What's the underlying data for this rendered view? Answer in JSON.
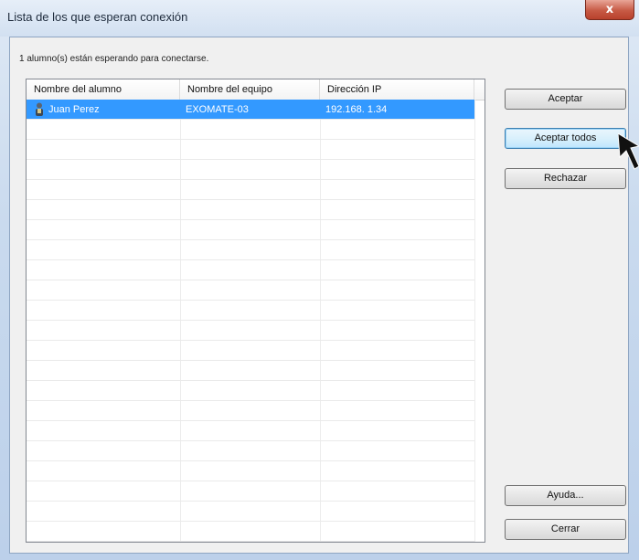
{
  "window": {
    "title": "Lista de los que esperan conexión",
    "close_label": "x"
  },
  "status_text": "1 alumno(s) están esperando para conectarse.",
  "list": {
    "columns": [
      "Nombre del alumno",
      "Nombre del equipo",
      "Dirección IP"
    ],
    "rows": [
      {
        "student": "Juan Perez",
        "computer": "EXOMATE-03",
        "ip": "192.168. 1.34",
        "selected": true
      }
    ]
  },
  "buttons": {
    "accept": "Aceptar",
    "accept_all": "Aceptar todos",
    "reject": "Rechazar",
    "help": "Ayuda...",
    "close": "Cerrar"
  },
  "colors": {
    "selection": "#3399ff",
    "close_button": "#c75a45"
  },
  "icons": {
    "row_icon": "user-icon",
    "cursor": "mouse-pointer-icon"
  }
}
